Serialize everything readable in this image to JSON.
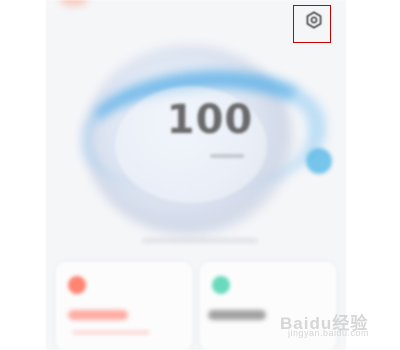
{
  "screen": {
    "score": "100",
    "settings_icon": "gear-icon",
    "highlight_color": "#c40000",
    "accent_blue": "#58afe8",
    "accent_orange": "#ff6149",
    "accent_green": "#34cda5"
  },
  "watermark": {
    "logo": "Baidu经验",
    "url": "jingyan.baidu.com"
  }
}
